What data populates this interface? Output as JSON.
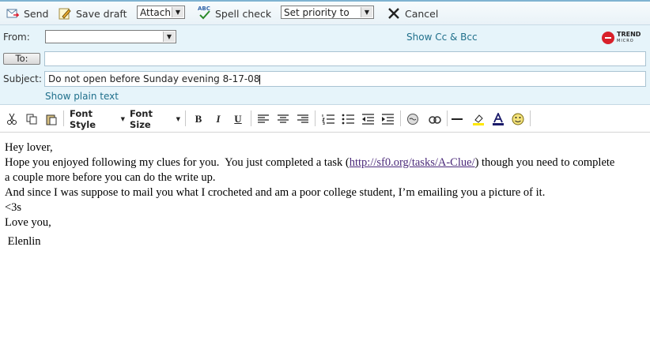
{
  "toolbar": {
    "send_label": "Send",
    "save_draft_label": "Save draft",
    "attach_label": "Attach",
    "spell_check_label": "Spell check",
    "spell_icon_text": "ABC",
    "priority_label": "Set priority to",
    "cancel_label": "Cancel"
  },
  "header": {
    "from_label": "From:",
    "from_value": "",
    "show_cc_bcc": "Show Cc & Bcc",
    "to_button": "To:",
    "to_value": "",
    "subject_label": "Subject:",
    "subject_value": "Do not open before Sunday evening 8-17-08",
    "show_plain_text": "Show plain text",
    "logo_top": "TREND",
    "logo_bottom": "MICRO"
  },
  "format": {
    "font_style": "Font Style",
    "font_size": "Font Size",
    "bold": "B",
    "italic": "I",
    "underline": "U"
  },
  "message": {
    "line1": "Hey lover,",
    "line2_before": "Hope you enjoyed following my clues for you.  You just completed a task (",
    "link": "http://sf0.org/tasks/A-Clue/",
    "line2_after": ") though you need to complete",
    "line3": "a couple more before you can do the write up.",
    "line4": "And since I was suppose to mail you what I crocheted and am a poor college student, I’m emailing you a picture of it.",
    "line5": "<3s",
    "line6": "Love you,",
    "line7": " Elenlin"
  },
  "colors": {
    "accent": "#1f6f8b",
    "header_bg": "#e6f4fa",
    "link": "#4b2a7a"
  }
}
